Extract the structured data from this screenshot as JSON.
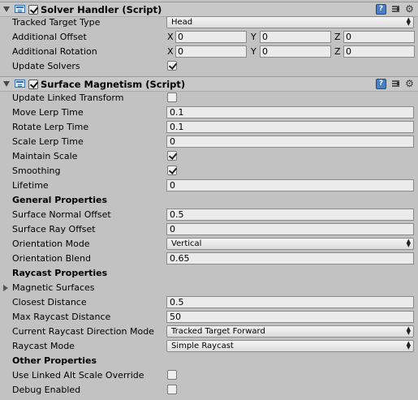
{
  "solver_handler": {
    "title": "Solver Handler (Script)",
    "enabled": true,
    "tracked_target_type_label": "Tracked Target Type",
    "tracked_target_type_value": "Head",
    "additional_offset_label": "Additional Offset",
    "additional_offset": {
      "x": "0",
      "y": "0",
      "z": "0"
    },
    "additional_rotation_label": "Additional Rotation",
    "additional_rotation": {
      "x": "0",
      "y": "0",
      "z": "0"
    },
    "update_solvers_label": "Update Solvers",
    "update_solvers": true,
    "axis_x": "X",
    "axis_y": "Y",
    "axis_z": "Z"
  },
  "surface_magnetism": {
    "title": "Surface Magnetism (Script)",
    "enabled": true,
    "update_linked_transform_label": "Update Linked Transform",
    "update_linked_transform": false,
    "move_lerp_time_label": "Move Lerp Time",
    "move_lerp_time": "0.1",
    "rotate_lerp_time_label": "Rotate Lerp Time",
    "rotate_lerp_time": "0.1",
    "scale_lerp_time_label": "Scale Lerp Time",
    "scale_lerp_time": "0",
    "maintain_scale_label": "Maintain Scale",
    "maintain_scale": true,
    "smoothing_label": "Smoothing",
    "smoothing": true,
    "lifetime_label": "Lifetime",
    "lifetime": "0",
    "general_properties_heading": "General Properties",
    "surface_normal_offset_label": "Surface Normal Offset",
    "surface_normal_offset": "0.5",
    "surface_ray_offset_label": "Surface Ray Offset",
    "surface_ray_offset": "0",
    "orientation_mode_label": "Orientation Mode",
    "orientation_mode": "Vertical",
    "orientation_blend_label": "Orientation Blend",
    "orientation_blend": "0.65",
    "raycast_properties_heading": "Raycast Properties",
    "magnetic_surfaces_label": "Magnetic Surfaces",
    "closest_distance_label": "Closest Distance",
    "closest_distance": "0.5",
    "max_raycast_distance_label": "Max Raycast Distance",
    "max_raycast_distance": "50",
    "current_raycast_direction_mode_label": "Current Raycast Direction Mode",
    "current_raycast_direction_mode": "Tracked Target Forward",
    "raycast_mode_label": "Raycast Mode",
    "raycast_mode": "Simple Raycast",
    "other_properties_heading": "Other Properties",
    "use_linked_alt_scale_override_label": "Use Linked Alt Scale Override",
    "use_linked_alt_scale_override": false,
    "debug_enabled_label": "Debug Enabled",
    "debug_enabled": false
  },
  "icons": {
    "help": "help-icon",
    "preset": "preset-icon",
    "gear": "gear-icon",
    "help_glyph": "?",
    "gear_glyph": "⚙"
  }
}
